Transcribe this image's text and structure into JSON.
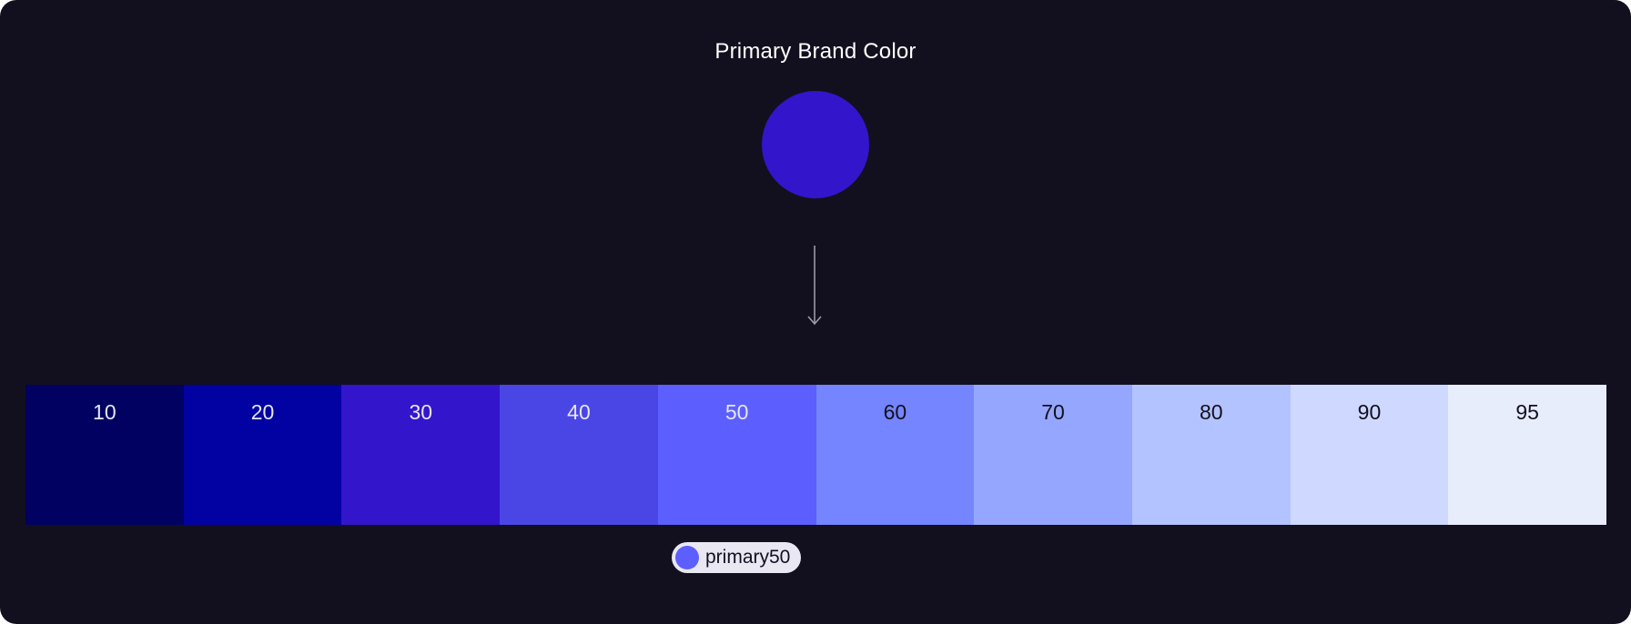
{
  "title": "Primary Brand Color",
  "brand_color": "#3315cc",
  "arrow_color": "#9a99a6",
  "scale": [
    {
      "label": "10",
      "color": "#010162",
      "text_color": "#e6e6f4"
    },
    {
      "label": "20",
      "color": "#0202a3",
      "text_color": "#e6e6f4"
    },
    {
      "label": "30",
      "color": "#3315cc",
      "text_color": "#e6e6f4"
    },
    {
      "label": "40",
      "color": "#4a46e6",
      "text_color": "#e6e6f4"
    },
    {
      "label": "50",
      "color": "#5c5ffe",
      "text_color": "#e6e6f4"
    },
    {
      "label": "60",
      "color": "#7584ff",
      "text_color": "#12101e"
    },
    {
      "label": "70",
      "color": "#95a6ff",
      "text_color": "#12101e"
    },
    {
      "label": "80",
      "color": "#b3c3ff",
      "text_color": "#12101e"
    },
    {
      "label": "90",
      "color": "#cfd9ff",
      "text_color": "#12101e"
    },
    {
      "label": "95",
      "color": "#e8edfc",
      "text_color": "#12101e"
    }
  ],
  "token": {
    "label": "primary50",
    "color": "#5c5ffe"
  }
}
